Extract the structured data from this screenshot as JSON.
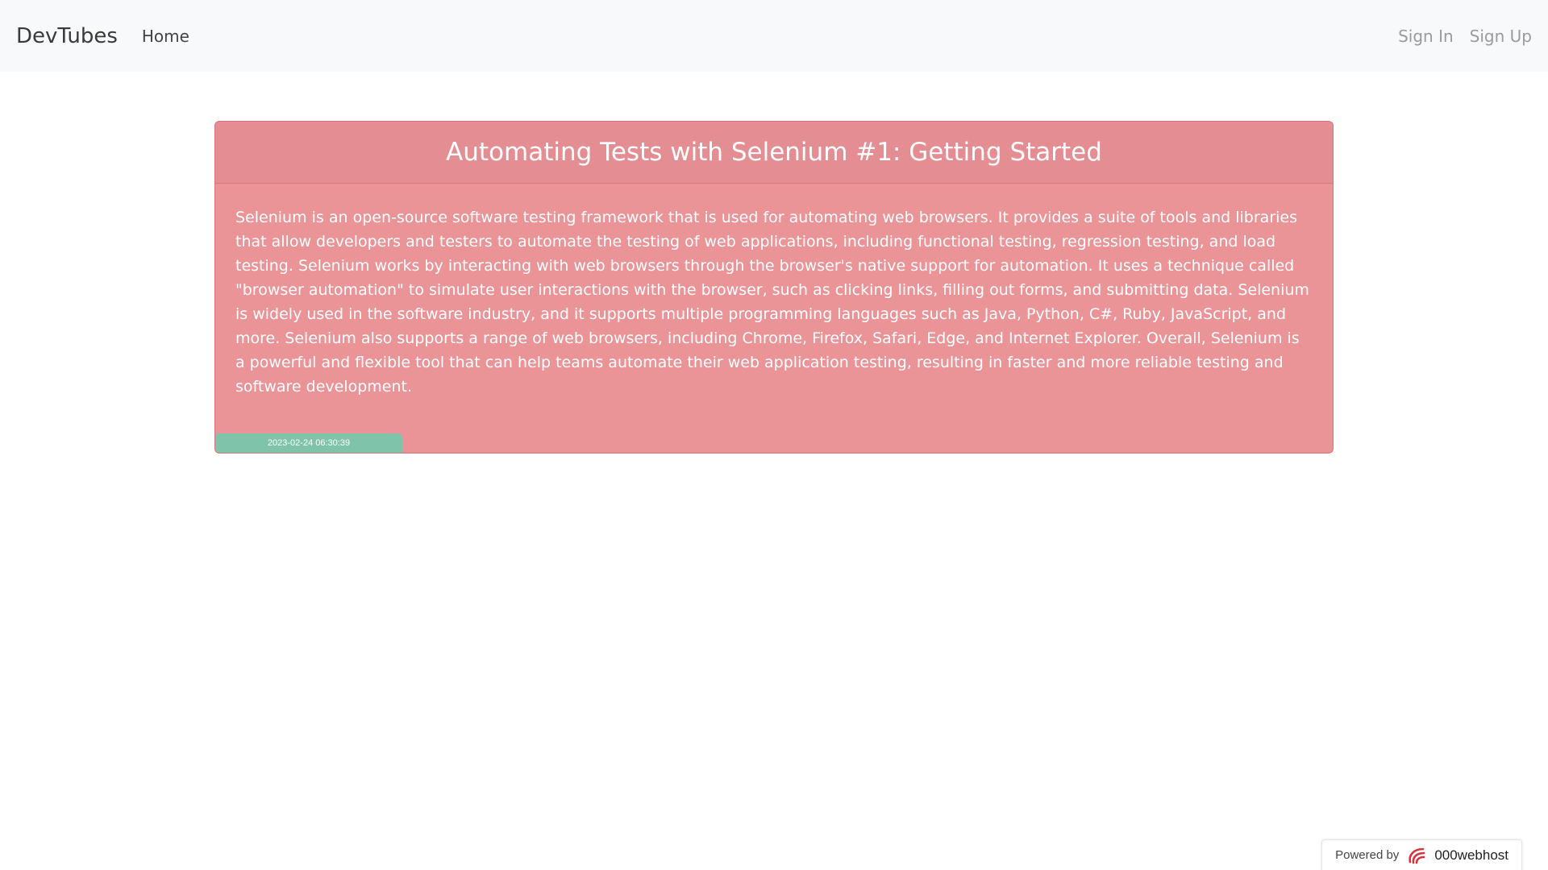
{
  "navbar": {
    "brand": "DevTubes",
    "home_label": "Home",
    "signin_label": "Sign In",
    "signup_label": "Sign Up"
  },
  "post": {
    "title": "Automating Tests with Selenium #1: Getting Started",
    "body": "Selenium is an open-source software testing framework that is used for automating web browsers. It provides a suite of tools and libraries that allow developers and testers to automate the testing of web applications, including functional testing, regression testing, and load testing. Selenium works by interacting with web browsers through the browser's native support for automation. It uses a technique called \"browser automation\" to simulate user interactions with the browser, such as clicking links, filling out forms, and submitting data. Selenium is widely used in the software industry, and it supports multiple programming languages such as Java, Python, C#, Ruby, JavaScript, and more. Selenium also supports a range of web browsers, including Chrome, Firefox, Safari, Edge, and Internet Explorer. Overall, Selenium is a powerful and flexible tool that can help teams automate their web application testing, resulting in faster and more reliable testing and software development.",
    "timestamp": "2023-02-24 06:30:39"
  },
  "footer": {
    "powered_label": "Powered by",
    "host_icon": "000webhost-logo-icon",
    "host_name": "000webhost"
  },
  "colors": {
    "card_background": "#eb9498",
    "card_header": "#e48d93",
    "timestamp_badge": "#7fc3ab",
    "navbar_background": "#f8f9fa"
  }
}
